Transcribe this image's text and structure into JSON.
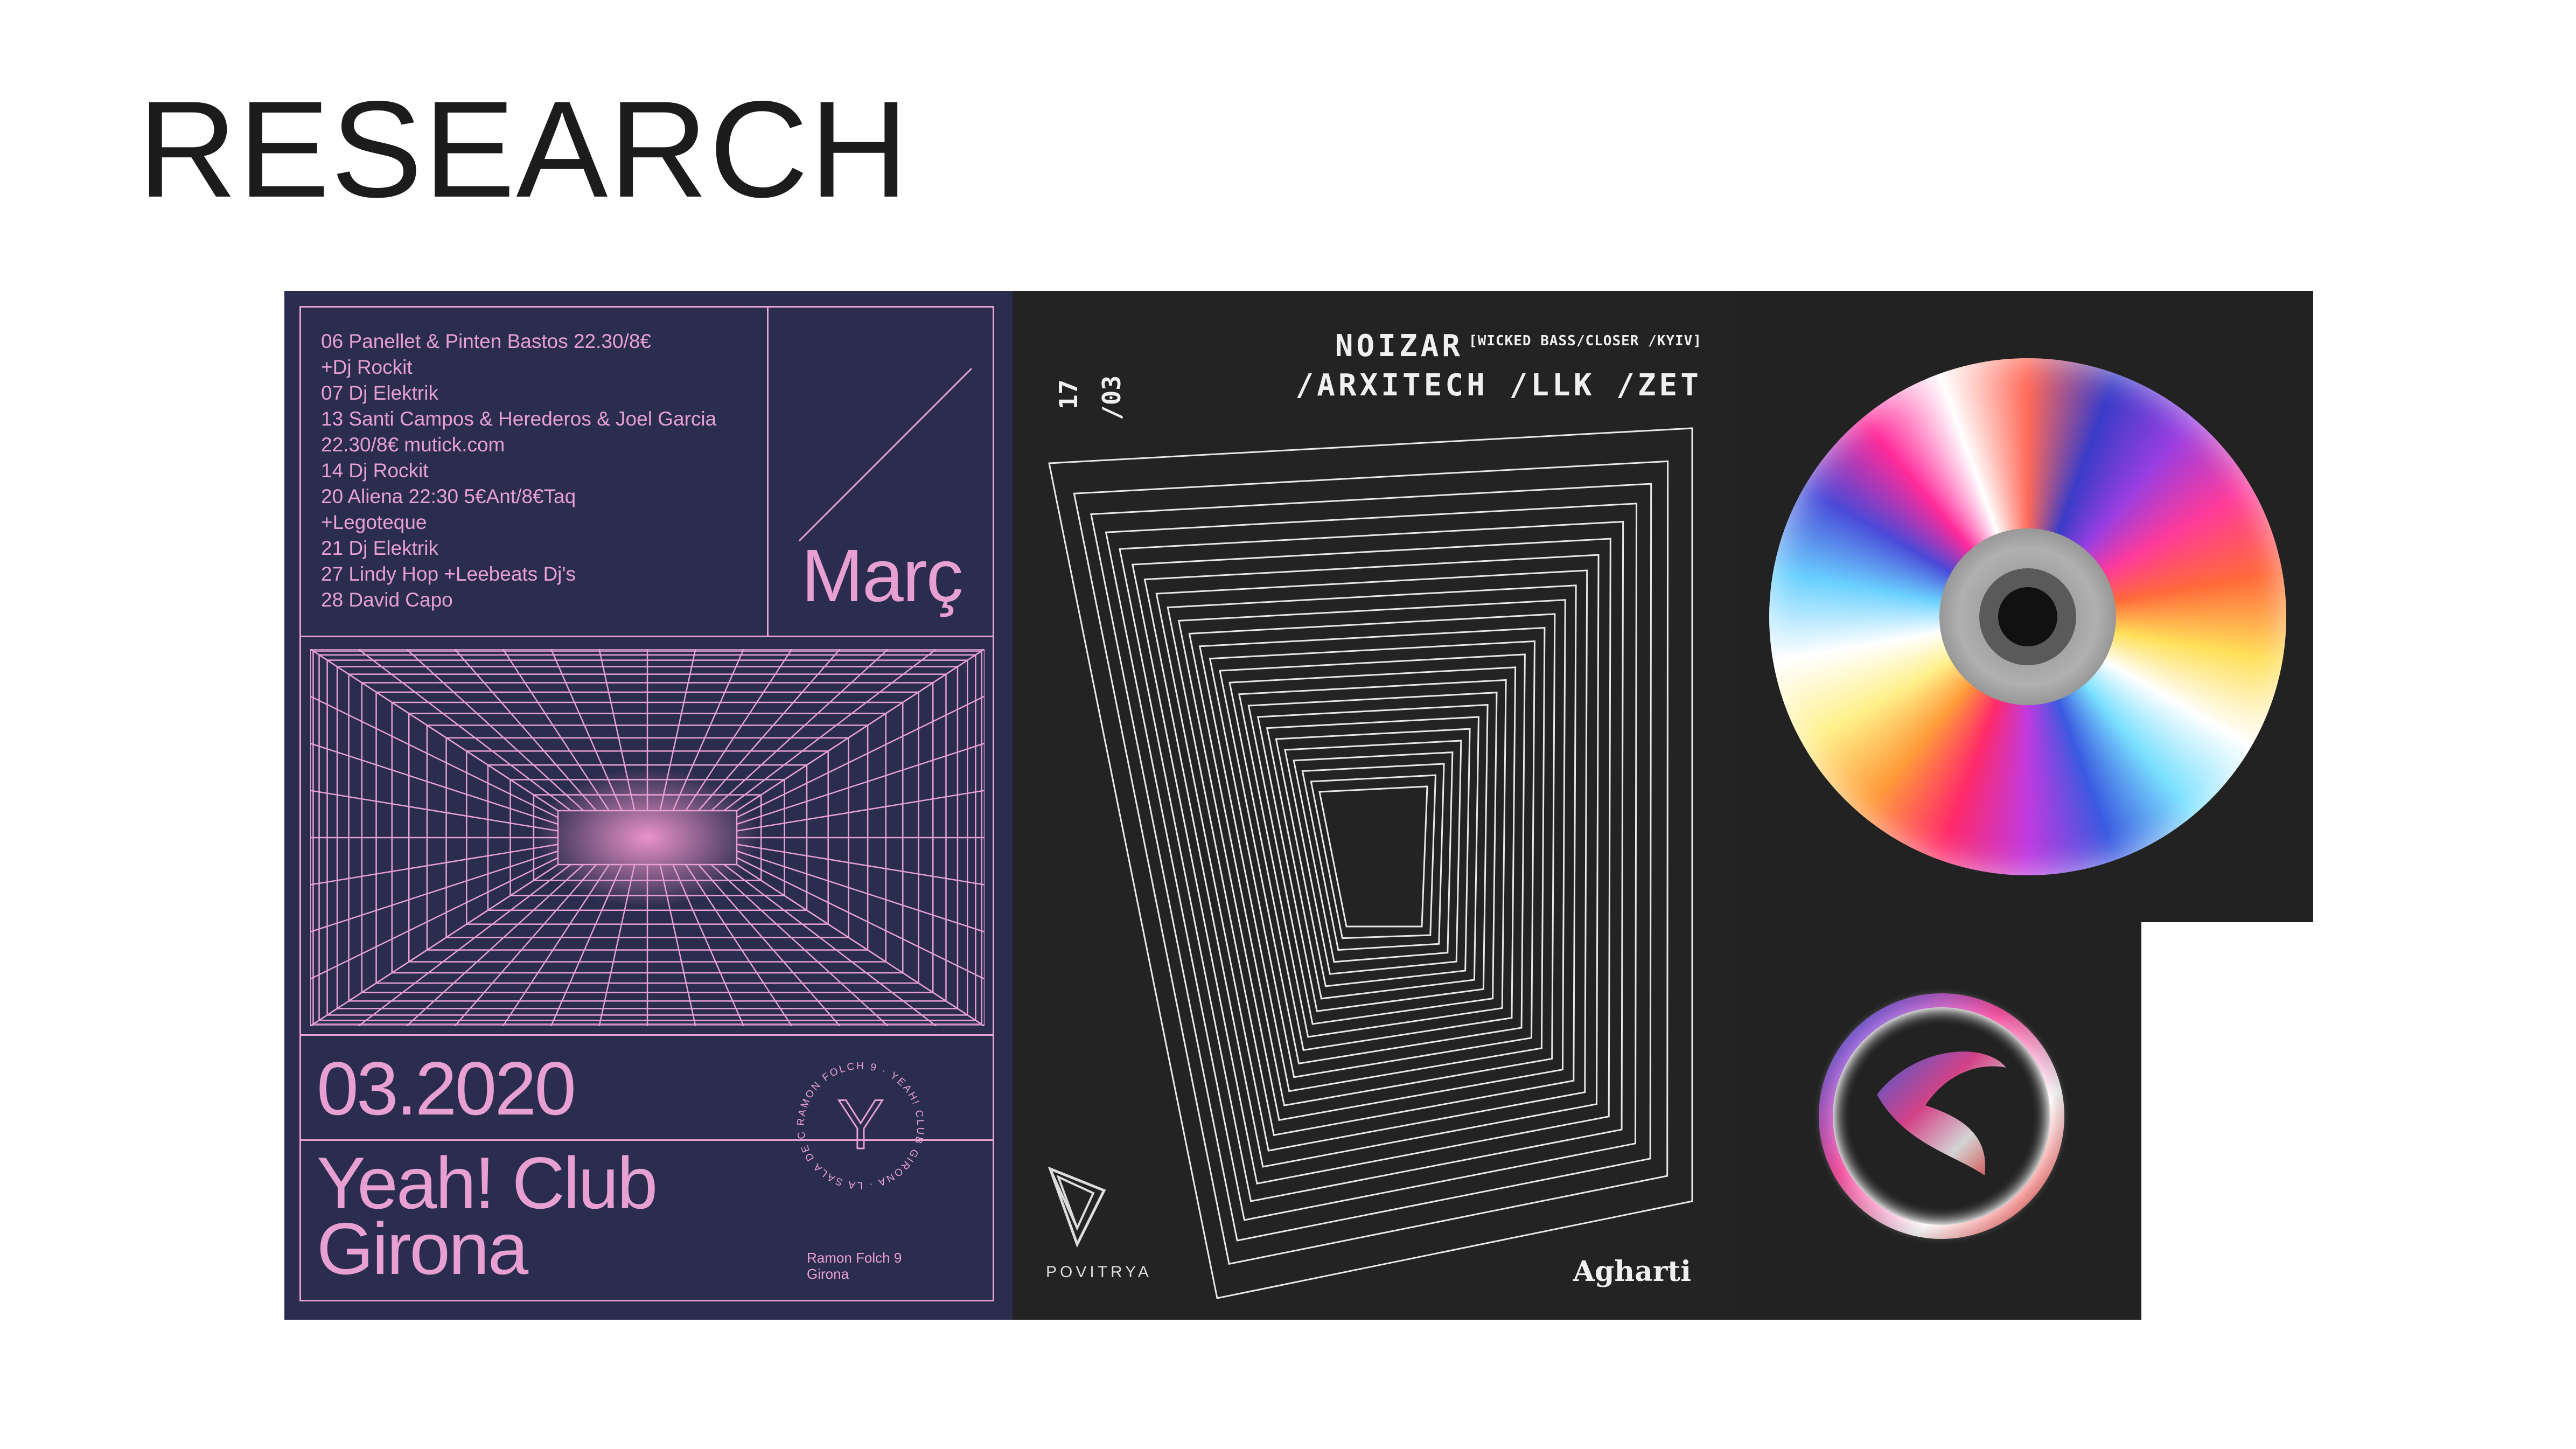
{
  "page": {
    "title": "RESEARCH"
  },
  "poster1": {
    "events": [
      "06 Panellet & Pinten Bastos 22.30/8€",
      "+Dj Rockit",
      "07 Dj Elektrik",
      "13 Santi Campos & Herederos & Joel Garcia",
      "22.30/8€ mutick.com",
      "14 Dj Rockit",
      "20 Aliena  22:30  5€Ant/8€Taq",
      "+Legoteque",
      "21 Dj Elektrik",
      "27 Lindy Hop +Leebeats Dj's",
      "28 David Capo"
    ],
    "month": "Març",
    "date": "03.2020",
    "club_line1": "Yeah! Club",
    "club_line2": "Girona",
    "address_line1": "Ramon Folch 9",
    "address_line2": "Girona",
    "seal_text": "RAMON FOLCH 9 · YEAH! CLUB GIRONA · LA SALA DE CULTE ·",
    "seal_letter": "Y",
    "color": "#e8a0d3",
    "background": "#2b2d4e"
  },
  "poster2": {
    "date_day": "17",
    "date_month": "/03",
    "lineup_main": "NOIZAR",
    "lineup_tags": "[WICKED BASS/CLOSER /KYIV]",
    "lineup_line2": "/ARXITECH /LLK /ZET",
    "brand_left": "POVITRYA",
    "brand_right": "Agharti",
    "background": "#232323"
  },
  "panel3": {
    "background": "#222222",
    "top_image": "compact-disc",
    "bottom_image": "iridescent-orb"
  }
}
